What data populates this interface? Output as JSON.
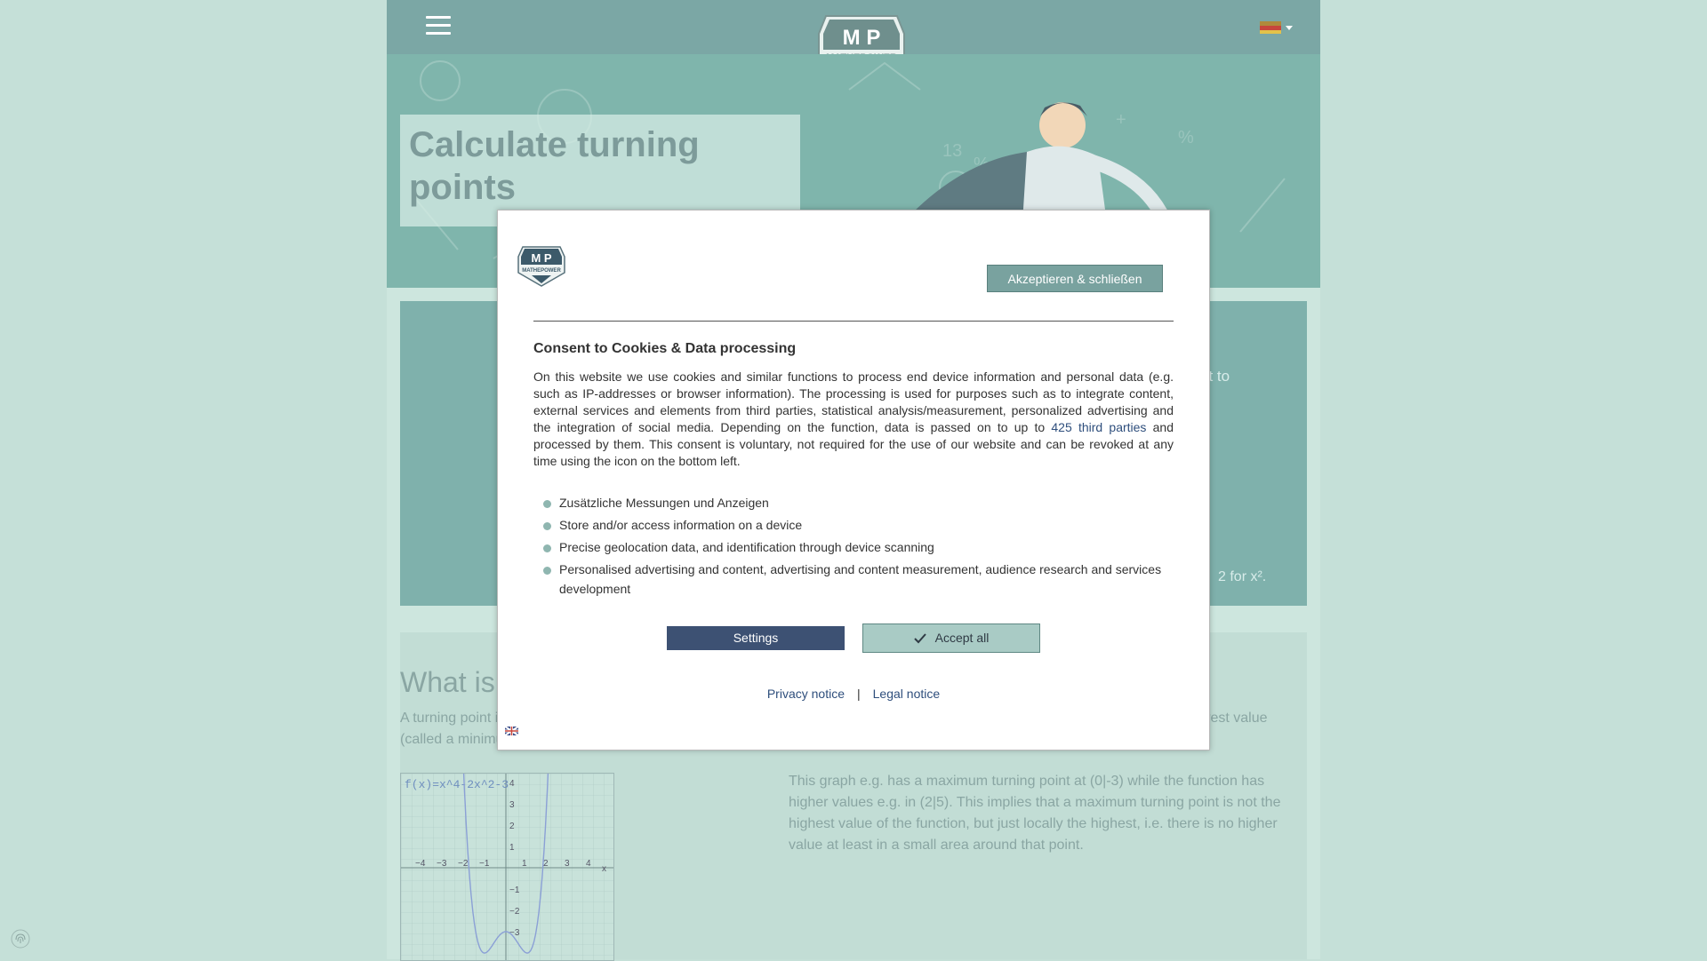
{
  "header": {
    "logo_text": "MATHEPOWER",
    "logo_letters": "M P",
    "language_flag": "germany-flag"
  },
  "hero": {
    "title": "Calculate turning points"
  },
  "content": {
    "intro_fragment_right": "nt to",
    "example_fragment": "2 for x².",
    "section_heading": "What is",
    "para1_start": "A turning point i",
    "para1_right": "y lowest value",
    "para1_line2": "(called a minimu",
    "graph_label": "f(x)=x^4-2x^2-3",
    "graph_x_ticks": [
      "−4",
      "−3",
      "−2",
      "−1",
      "1",
      "2",
      "3",
      "4"
    ],
    "graph_y_ticks": [
      "4",
      "3",
      "2",
      "1",
      "−1",
      "−2",
      "−3"
    ],
    "graph_x_axis": "x",
    "para2": "This graph e.g. has a maximum turning point at (0|-3) while the function has higher values e.g. in (2|5). This implies that a maximum turning point is not the highest value of the function, but just locally the highest, i.e. there is no higher value at least in a small area around that point."
  },
  "consent": {
    "accept_close_label": "Akzeptieren & schließen",
    "title": "Consent to Cookies & Data processing",
    "body_before_link": "On this website we use cookies and similar functions to process end device information and personal data (e.g. such as IP-addresses or browser information). The processing is used for purposes such as to integrate content, external services and elements from third parties, statistical analysis/measurement, personalized advertising and the integration of social media. Depending on the function, data is passed on to up to ",
    "body_link": "425 third parties",
    "body_after_link": " and processed by them. This consent is voluntary, not required for the use of our website and can be revoked at any time using the icon on the bottom left.",
    "purposes": [
      "Zusätzliche Messungen und Anzeigen",
      "Store and/or access information on a device",
      "Precise geolocation data, and identification through device scanning",
      "Personalised advertising and content, advertising and content measurement, audience research and services development"
    ],
    "settings_label": "Settings",
    "accept_all_label": "Accept all",
    "privacy_label": "Privacy notice",
    "separator": "|",
    "legal_label": "Legal notice",
    "language_icon": "uk-flag-icon"
  },
  "colors": {
    "topbar": "#7ba7a5",
    "settings_button": "#3d5173",
    "accept_button": "#a9cbc5",
    "link": "#2e4e7c"
  }
}
